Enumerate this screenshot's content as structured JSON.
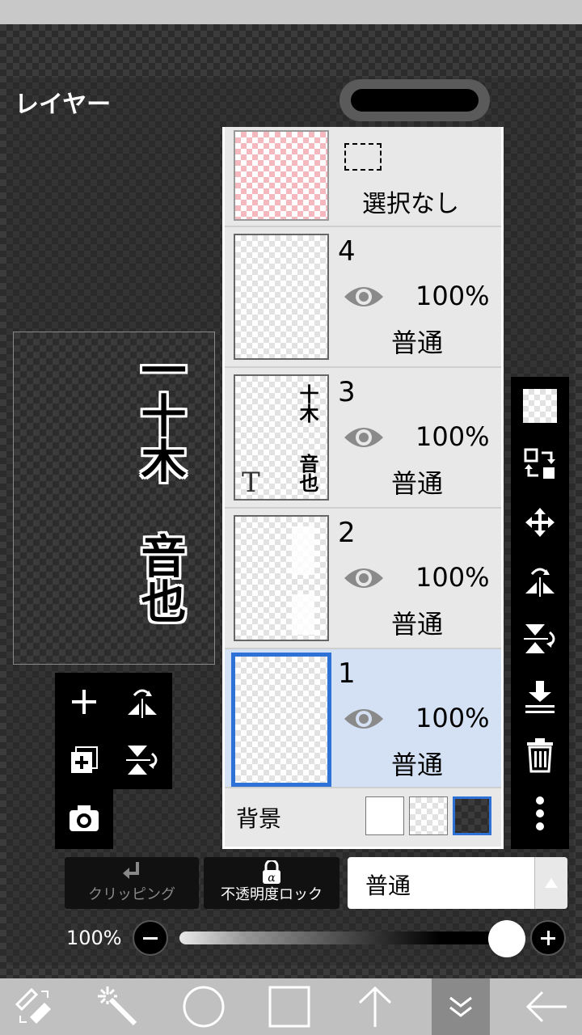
{
  "panel": {
    "title": "レイヤー"
  },
  "canvas_text": {
    "line1": "一十木",
    "line2": "音也"
  },
  "selection_row": {
    "label": "選択なし"
  },
  "layers": [
    {
      "number": "4",
      "opacity": "100%",
      "blend": "普通",
      "selected": false
    },
    {
      "number": "3",
      "opacity": "100%",
      "blend": "普通",
      "selected": false,
      "thumb_text_1": "十木",
      "thumb_text_2": "音也",
      "thumb_badge": "T"
    },
    {
      "number": "2",
      "opacity": "100%",
      "blend": "普通",
      "selected": false
    },
    {
      "number": "1",
      "opacity": "100%",
      "blend": "普通",
      "selected": true
    }
  ],
  "background_row": {
    "label": "背景"
  },
  "bottom_controls": {
    "clipping_label": "クリッピング",
    "alpha_lock_label": "不透明度ロック",
    "blend_mode": "普通",
    "opacity_label": "100%",
    "opacity_value": 1.0
  },
  "colors": {
    "selection_blue": "#2e72d8",
    "selected_row": "#d4e0f4"
  },
  "icons": {
    "right_toolbar": [
      "transparency-icon",
      "swap-layer-icon",
      "move-icon",
      "flip-horizontal-icon",
      "flip-vertical-icon",
      "merge-down-icon",
      "trash-icon",
      "more-icon"
    ],
    "left_tools": [
      "add-layer-icon",
      "flip-horizontal-icon",
      "add-copy-layer-icon",
      "flip-vertical-icon",
      "camera-icon"
    ],
    "bottom_bar": [
      "pen-eraser-icon",
      "magic-wand-icon",
      "circle-icon",
      "square-icon",
      "arrow-up-icon",
      "collapse-icon",
      "back-arrow-icon"
    ]
  }
}
